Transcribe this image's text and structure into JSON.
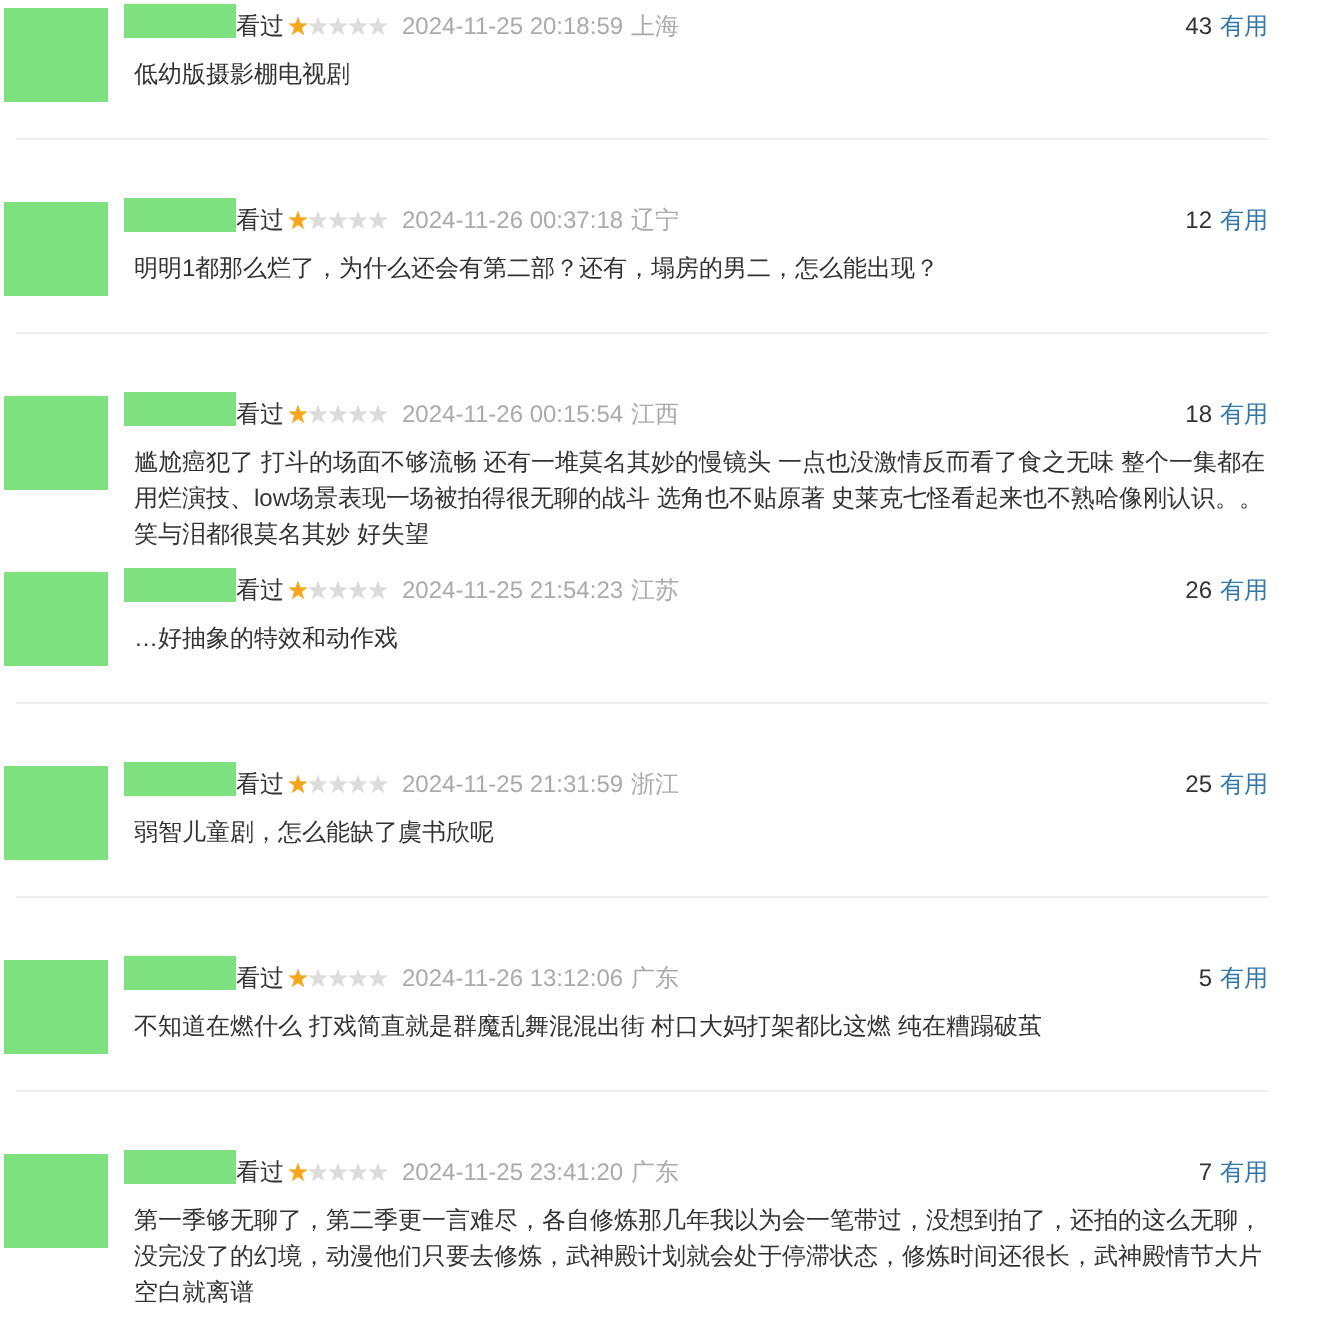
{
  "comments": [
    {
      "status": "看过",
      "stars": 1,
      "time": "2024-11-25 20:18:59",
      "location": "上海",
      "votes": "43",
      "vote_label": "有用",
      "text": "低幼版摄影棚电视剧",
      "divider_below": true
    },
    {
      "status": "看过",
      "stars": 1,
      "time": "2024-11-26 00:37:18",
      "location": "辽宁",
      "votes": "12",
      "vote_label": "有用",
      "text": "明明1都那么烂了，为什么还会有第二部？还有，塌房的男二，怎么能出现？",
      "divider_below": true
    },
    {
      "status": "看过",
      "stars": 1,
      "time": "2024-11-26 00:15:54",
      "location": "江西",
      "votes": "18",
      "vote_label": "有用",
      "text": "尴尬癌犯了 打斗的场面不够流畅 还有一堆莫名其妙的慢镜头 一点也没激情反而看了食之无味 整个一集都在用烂演技、low场景表现一场被拍得很无聊的战斗 选角也不贴原著 史莱克七怪看起来也不熟哈像刚认识。。笑与泪都很莫名其妙 好失望",
      "divider_below": false
    },
    {
      "status": "看过",
      "stars": 1,
      "time": "2024-11-25 21:54:23",
      "location": "江苏",
      "votes": "26",
      "vote_label": "有用",
      "text": "…好抽象的特效和动作戏",
      "divider_below": true
    },
    {
      "status": "看过",
      "stars": 1,
      "time": "2024-11-25 21:31:59",
      "location": "浙江",
      "votes": "25",
      "vote_label": "有用",
      "text": "弱智儿童剧，怎么能缺了虞书欣呢",
      "divider_below": true
    },
    {
      "status": "看过",
      "stars": 1,
      "time": "2024-11-26 13:12:06",
      "location": "广东",
      "votes": "5",
      "vote_label": "有用",
      "text": "不知道在燃什么 打戏简直就是群魔乱舞混混出街 村口大妈打架都比这燃 纯在糟蹋破茧",
      "divider_below": true
    },
    {
      "status": "看过",
      "stars": 1,
      "time": "2024-11-25 23:41:20",
      "location": "广东",
      "votes": "7",
      "vote_label": "有用",
      "text": "第一季够无聊了，第二季更一言难尽，各自修炼那几年我以为会一笔带过，没想到拍了，还拍的这么无聊，没完没了的幻境，动漫他们只要去修炼，武神殿计划就会处于停滞状态，修炼时间还很长，武神殿情节大片空白就离谱",
      "divider_below": false
    }
  ]
}
